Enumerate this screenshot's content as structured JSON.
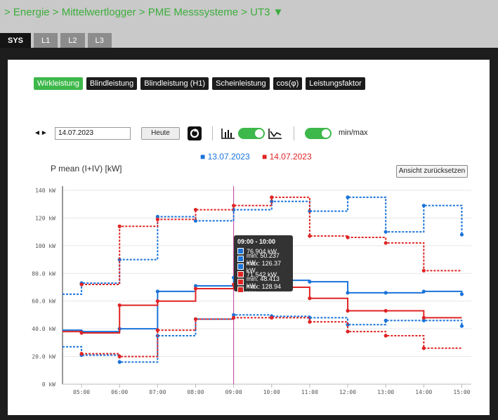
{
  "breadcrumb": "> Energie > Mittelwertlogger > PME Messsysteme > UT3 ▼",
  "tabs": [
    "SYS",
    "L1",
    "L2",
    "L3"
  ],
  "buttons": [
    "Wirkleistung",
    "Blindleistung",
    "Blindleistung (H1)",
    "Scheinleistung",
    "cos(φ)",
    "Leistungsfaktor"
  ],
  "controls": {
    "date_value": "14.07.2023",
    "today_label": "Heute",
    "minmax_label": "min/max",
    "reset_label": "Ansicht zurücksetzen",
    "nav_arrows": "◄►"
  },
  "colors": {
    "accent": "#3db84a",
    "series_a": "#1a73d9",
    "series_b": "#e02424",
    "cursor": "#c0399a"
  },
  "tooltip": {
    "title": "09:00 - 10:00",
    "rows": [
      "76.904 kW",
      "min: 50.237 kW",
      "max: 126.37 kW",
      "71.542 kW",
      "min: 48.413 kW",
      "max: 128.94 kW"
    ]
  },
  "chart_data": {
    "type": "line",
    "ylabel": "P mean (I+IV) [kW]",
    "step": true,
    "x": [
      "04:30",
      "05:00",
      "06:00",
      "07:00",
      "08:00",
      "09:00",
      "10:00",
      "11:00",
      "12:00",
      "13:00",
      "14:00",
      "15:00"
    ],
    "ylim": [
      0,
      140
    ],
    "yticks": [
      "0 kW",
      "20.0 kW",
      "40.0 kW",
      "60.0 kW",
      "80.0 kW",
      "100 kW",
      "120 kW",
      "140 kW"
    ],
    "xticks": [
      "05:00",
      "06:00",
      "07:00",
      "08:00",
      "09:00",
      "10:00",
      "11:00",
      "12:00",
      "13:00",
      "14:00",
      "15:00"
    ],
    "cursor_x": "09:00",
    "series": [
      {
        "name": "13.07.2023",
        "color": "#1a73d9",
        "mean": [
          39,
          38,
          40,
          67,
          71,
          77,
          75,
          74,
          66,
          66,
          67,
          65
        ],
        "min": [
          27,
          21,
          16,
          35,
          47,
          50,
          49,
          48,
          43,
          46,
          46,
          42
        ],
        "max": [
          65,
          73,
          90,
          121,
          118,
          126,
          132,
          125,
          135,
          110,
          129,
          108
        ]
      },
      {
        "name": "14.07.2023",
        "color": "#e02424",
        "mean": [
          38,
          37,
          57,
          60,
          69,
          72,
          70,
          62,
          53,
          53,
          48,
          null
        ],
        "min": [
          null,
          22,
          20,
          39,
          47,
          48,
          48,
          45,
          38,
          35,
          26,
          null
        ],
        "max": [
          null,
          72,
          114,
          119,
          126,
          129,
          135,
          107,
          106,
          102,
          82,
          null
        ]
      }
    ]
  }
}
